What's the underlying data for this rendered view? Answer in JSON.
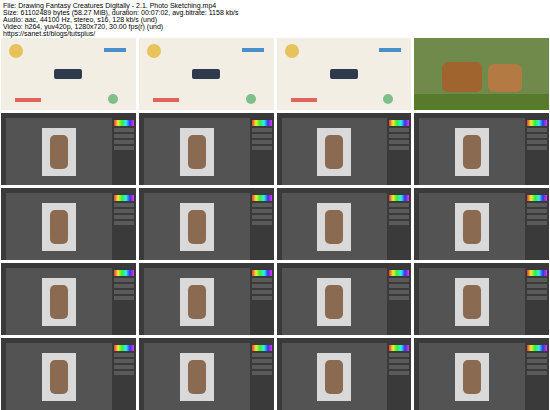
{
  "header": [
    "File: Drawing Fantasy Creatures Digitally - 2.1. Photo Sketching.mp4",
    "Size: 61102489 bytes (58.27 MiB), duration: 00:07:02, avg.bitrate: 1158 kb/s",
    "Audio: aac, 44100 Hz, stereo, s16, 128 kb/s (und)",
    "Video: h264, yuv420p, 1280x720, 30.00 fps(r) (und)",
    "https://sanet.st/blogs/tutsplus/"
  ],
  "frames": [
    {
      "kind": "title"
    },
    {
      "kind": "title"
    },
    {
      "kind": "title"
    },
    {
      "kind": "photo"
    },
    {
      "kind": "editor"
    },
    {
      "kind": "editor"
    },
    {
      "kind": "editor"
    },
    {
      "kind": "editor"
    },
    {
      "kind": "editor"
    },
    {
      "kind": "editor"
    },
    {
      "kind": "editor"
    },
    {
      "kind": "editor"
    },
    {
      "kind": "editor"
    },
    {
      "kind": "editor"
    },
    {
      "kind": "editor"
    },
    {
      "kind": "editor"
    },
    {
      "kind": "editor"
    },
    {
      "kind": "editor"
    },
    {
      "kind": "editor"
    },
    {
      "kind": "editor"
    }
  ]
}
